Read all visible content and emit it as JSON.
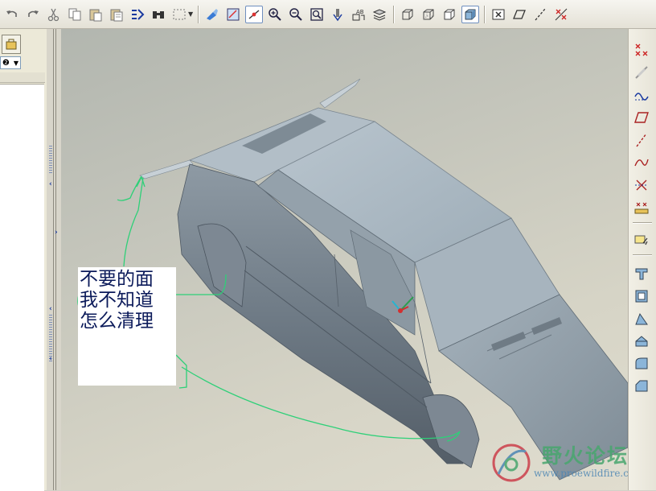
{
  "toolbar": {
    "icons": [
      "undo-icon",
      "redo-icon",
      "cut-icon",
      "copy-icon",
      "paste-icon",
      "paste-special-icon",
      "regenerate-icon",
      "find-icon",
      "select-box-icon",
      "sketch-toggle-icon",
      "sketch-view-icon",
      "datum-toggle-icon",
      "zoom-in-icon",
      "zoom-out-icon",
      "zoom-fit-icon",
      "reorient-icon",
      "annotation-icon",
      "layers-icon",
      "wireframe-icon",
      "hidden-line-icon",
      "no-hidden-icon",
      "shaded-icon",
      "close-window-icon",
      "datum-plane-icon",
      "datum-axis-icon",
      "datum-point-icon"
    ]
  },
  "annotation": {
    "lines": [
      "不要的面",
      "我不知道",
      "怎么清理"
    ],
    "stroke_color": "#2ed078"
  },
  "watermark": {
    "title": "野火论坛",
    "url": "www.proewildfire.cn"
  },
  "right_toolbar": {
    "icons": [
      "datum-point-icon",
      "datum-coord-icon",
      "datum-curve-icon",
      "datum-plane-icon",
      "datum-axis-icon",
      "sketch-curve-icon",
      "point-offset-icon",
      "analysis-icon",
      "insert-sketch-icon",
      "extrude-icon",
      "shell-icon",
      "draft-icon",
      "rib-icon",
      "round-icon",
      "chamfer-icon"
    ]
  },
  "colors": {
    "viewport_bg": "#c4c5bb",
    "model": "#a9b6c0",
    "accent_blue": "#1a3aa0"
  }
}
